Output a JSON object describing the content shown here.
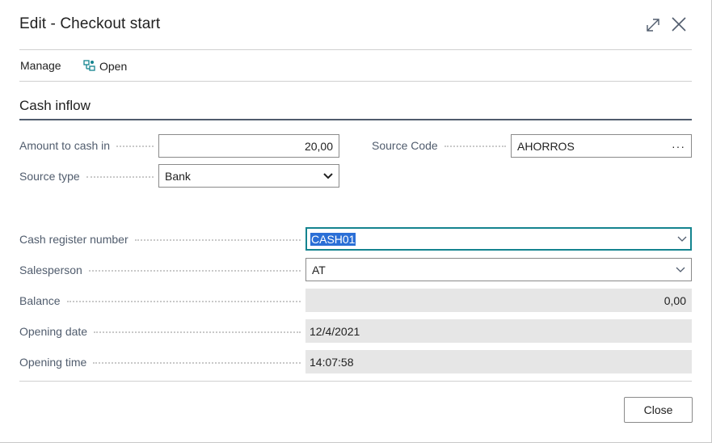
{
  "dialog": {
    "title": "Edit - Checkout start",
    "expand_icon": "expand-icon",
    "close_icon": "close-icon"
  },
  "actions": {
    "manage_label": "Manage",
    "open_label": "Open",
    "open_icon": "open-card-icon"
  },
  "section": {
    "title": "Cash inflow"
  },
  "fields": {
    "amount": {
      "label": "Amount to cash in",
      "value": "20,00"
    },
    "source_code": {
      "label": "Source Code",
      "value": "AHORROS",
      "lookup": "···"
    },
    "source_type": {
      "label": "Source type",
      "value": "Bank"
    },
    "cash_register": {
      "label": "Cash register number",
      "value": "CASH01"
    },
    "salesperson": {
      "label": "Salesperson",
      "value": "AT"
    },
    "balance": {
      "label": "Balance",
      "value": "0,00"
    },
    "opening_date": {
      "label": "Opening date",
      "value": "12/4/2021"
    },
    "opening_time": {
      "label": "Opening time",
      "value": "14:07:58"
    }
  },
  "footer": {
    "close_label": "Close"
  },
  "colors": {
    "accent_focus": "#14848f",
    "selection": "#2b6fd6",
    "readonly_bg": "#e6e6e6",
    "section_line": "#505c6d"
  }
}
